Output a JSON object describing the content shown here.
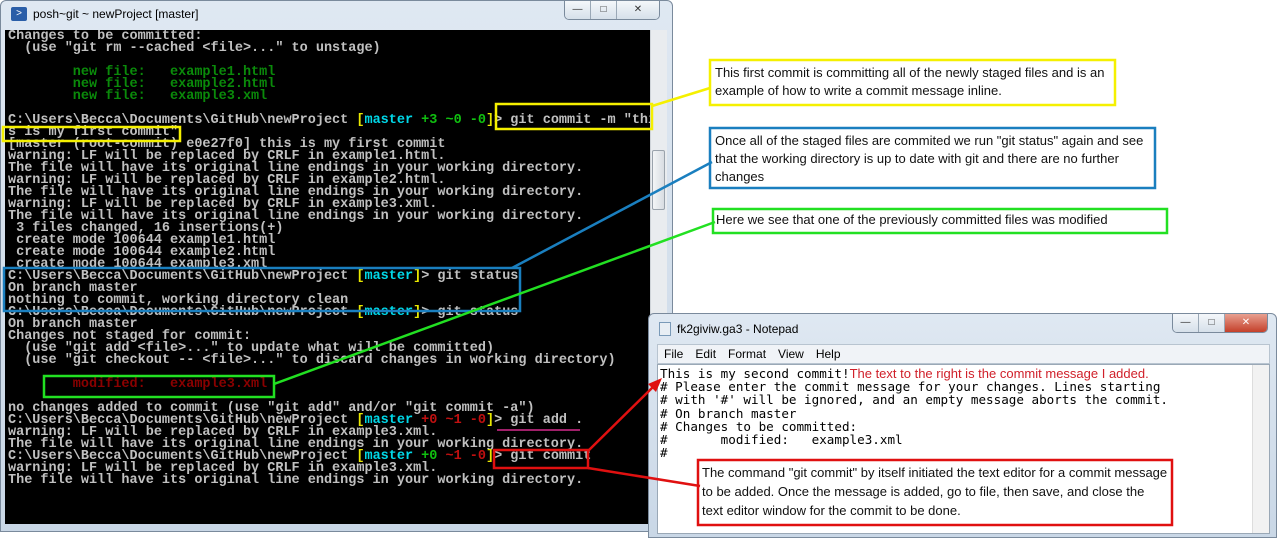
{
  "terminal": {
    "title": "posh~git ~ newProject [master]",
    "lines": [
      [
        [
          "Changes to be committed:",
          ""
        ]
      ],
      [
        [
          "  (use \"git rm --cached <file>...\" to unstage)",
          ""
        ]
      ],
      [
        [
          "",
          ""
        ]
      ],
      [
        [
          "        new file:   example1.html",
          "g"
        ]
      ],
      [
        [
          "        new file:   example2.html",
          "g"
        ]
      ],
      [
        [
          "        new file:   example3.xml",
          "g"
        ]
      ],
      [
        [
          "",
          ""
        ]
      ],
      [
        [
          "C:\\Users\\Becca\\Documents\\GitHub\\newProject ",
          ""
        ],
        [
          "[",
          "y"
        ],
        [
          "master",
          "c"
        ],
        [
          " +3 ~0 -0",
          "lg"
        ],
        [
          "]",
          "y"
        ],
        [
          "> git commit -m \"thi",
          ""
        ]
      ],
      [
        [
          "s is my first commit\"",
          ""
        ]
      ],
      [
        [
          "[master (root-commit) e0e27f0] this is my first commit",
          ""
        ]
      ],
      [
        [
          "warning: LF will be replaced by CRLF in example1.html.",
          ""
        ]
      ],
      [
        [
          "The file will have its original line endings in your working directory.",
          ""
        ]
      ],
      [
        [
          "warning: LF will be replaced by CRLF in example2.html.",
          ""
        ]
      ],
      [
        [
          "The file will have its original line endings in your working directory.",
          ""
        ]
      ],
      [
        [
          "warning: LF will be replaced by CRLF in example3.xml.",
          ""
        ]
      ],
      [
        [
          "The file will have its original line endings in your working directory.",
          ""
        ]
      ],
      [
        [
          " 3 files changed, 16 insertions(+)",
          ""
        ]
      ],
      [
        [
          " create mode 100644 example1.html",
          ""
        ]
      ],
      [
        [
          " create mode 100644 example2.html",
          ""
        ]
      ],
      [
        [
          " create mode 100644 example3.xml",
          ""
        ]
      ],
      [
        [
          "C:\\Users\\Becca\\Documents\\GitHub\\newProject ",
          ""
        ],
        [
          "[",
          "y"
        ],
        [
          "master",
          "c"
        ],
        [
          "]",
          "y"
        ],
        [
          "> git status",
          ""
        ]
      ],
      [
        [
          "On branch master",
          ""
        ]
      ],
      [
        [
          "nothing to commit, working directory clean",
          ""
        ]
      ],
      [
        [
          "C:\\Users\\Becca\\Documents\\GitHub\\newProject ",
          ""
        ],
        [
          "[",
          "y"
        ],
        [
          "master",
          "c"
        ],
        [
          "]",
          "y"
        ],
        [
          "> git status",
          ""
        ]
      ],
      [
        [
          "On branch master",
          ""
        ]
      ],
      [
        [
          "Changes not staged for commit:",
          ""
        ]
      ],
      [
        [
          "  (use \"git add <file>...\" to update what will be committed)",
          ""
        ]
      ],
      [
        [
          "  (use \"git checkout -- <file>...\" to discard changes in working directory)",
          ""
        ]
      ],
      [
        [
          "",
          ""
        ]
      ],
      [
        [
          "        modified:   example3.xml",
          "r"
        ]
      ],
      [
        [
          "",
          ""
        ]
      ],
      [
        [
          "no changes added to commit (use \"git add\" and/or \"git commit -a\")",
          ""
        ]
      ],
      [
        [
          "C:\\Users\\Becca\\Documents\\GitHub\\newProject ",
          ""
        ],
        [
          "[",
          "y"
        ],
        [
          "master",
          "c"
        ],
        [
          " +0 ~1 -0",
          "lr"
        ],
        [
          "]",
          "y"
        ],
        [
          "> git add .",
          ""
        ]
      ],
      [
        [
          "warning: LF will be replaced by CRLF in example3.xml.",
          ""
        ]
      ],
      [
        [
          "The file will have its original line endings in your working directory.",
          ""
        ]
      ],
      [
        [
          "C:\\Users\\Becca\\Documents\\GitHub\\newProject ",
          ""
        ],
        [
          "[",
          "y"
        ],
        [
          "master",
          "c"
        ],
        [
          " +0 ",
          "lg"
        ],
        [
          "~1 -0",
          "lr"
        ],
        [
          "]",
          "y"
        ],
        [
          "> git commit",
          ""
        ]
      ],
      [
        [
          "warning: LF will be replaced by CRLF in example3.xml.",
          ""
        ]
      ],
      [
        [
          "The file will have its original line endings in your working directory.",
          ""
        ]
      ]
    ]
  },
  "annotations": {
    "yellow": "This first commit is committing all of the newly staged files and is an example of how to write a commit message inline.",
    "blue": "Once all of the staged files are commited we run \"git status\" again and see that the working directory is up to date with git and there are no further changes",
    "green": "Here we see that one of the previously committed files was modified",
    "red": "The command \"git commit\" by itself initiated the text editor for a commit message to be added. Once the message is added, go to file, then save, and close the text editor window for the commit to be done.",
    "colors": {
      "yellow": "#f5f000",
      "blue": "#1a7fbf",
      "green": "#22e022",
      "red": "#e01010",
      "purple": "#a0206a"
    }
  },
  "notepad": {
    "title": "fk2giviw.ga3 - Notepad",
    "menu": [
      "File",
      "Edit",
      "Format",
      "View",
      "Help"
    ],
    "first_line": "This is my second commit!",
    "first_line_note": "The text to the right is the commit message I added.",
    "body": "\n# Please enter the commit message for your changes. Lines starting\n# with '#' will be ignored, and an empty message aborts the commit.\n# On branch master\n# Changes to be committed:\n#       modified:   example3.xml\n#"
  },
  "window_controls": {
    "minimize": "minimize-icon",
    "maximize": "maximize-icon",
    "close": "close-icon"
  }
}
